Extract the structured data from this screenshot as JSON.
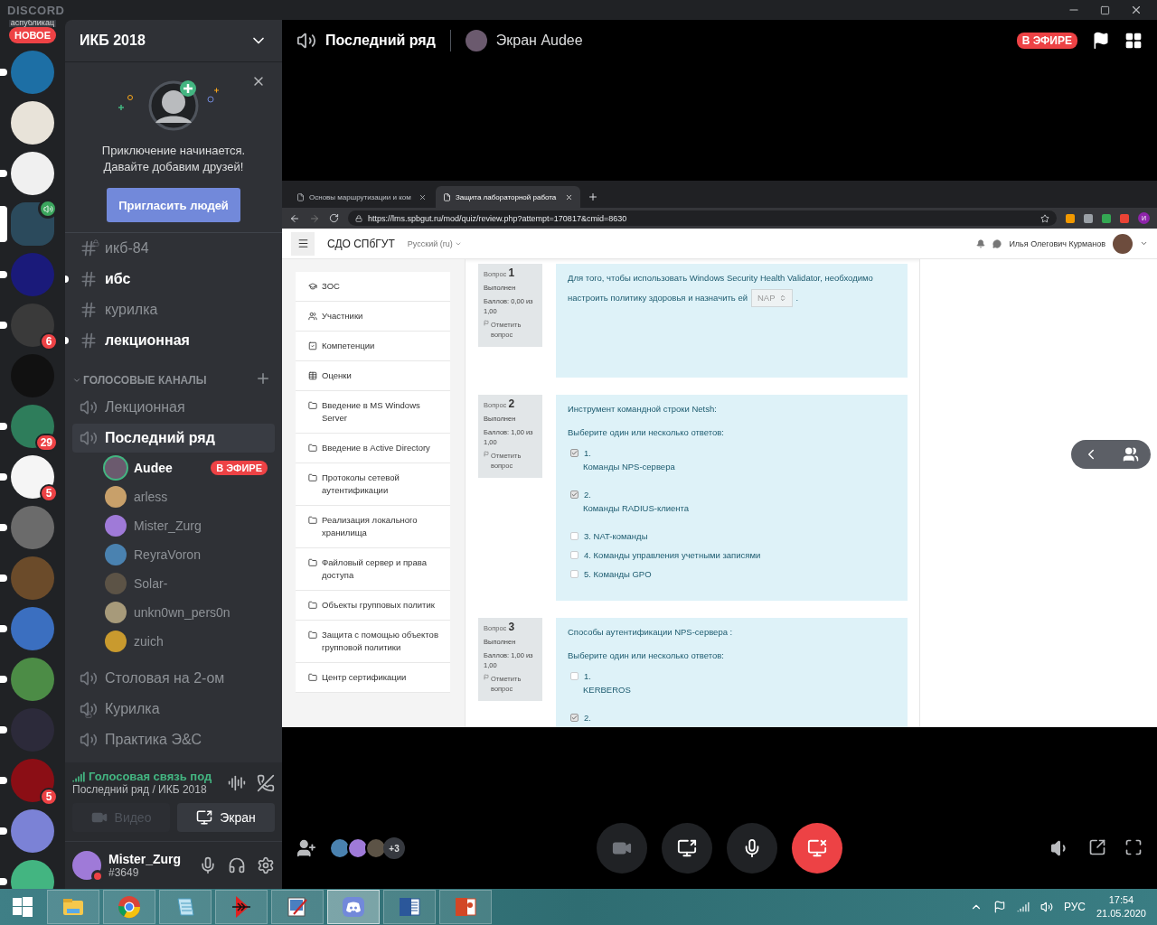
{
  "app_name": "DISCORD",
  "server_list": {
    "caption": "аспубликац",
    "new_badge": "НОВОЕ",
    "servers": [
      {
        "selected": false,
        "unread": true
      },
      {
        "selected": false,
        "unread": false
      },
      {
        "selected": false,
        "unread": true
      },
      {
        "selected": true,
        "unread": false,
        "voice": true
      },
      {
        "selected": false,
        "unread": true
      },
      {
        "selected": false,
        "unread": true,
        "badge": "6"
      },
      {
        "selected": false,
        "unread": false
      },
      {
        "selected": false,
        "unread": true,
        "badge": "29"
      },
      {
        "selected": false,
        "unread": true,
        "badge": "5"
      },
      {
        "selected": false,
        "unread": true
      },
      {
        "selected": false,
        "unread": true
      },
      {
        "selected": false,
        "unread": true
      },
      {
        "selected": false,
        "unread": true
      },
      {
        "selected": false,
        "unread": true
      },
      {
        "selected": false,
        "unread": true,
        "badge": "5"
      },
      {
        "selected": false,
        "unread": true
      },
      {
        "selected": false,
        "unread": true
      }
    ]
  },
  "server": {
    "name": "ИКБ 2018"
  },
  "invite": {
    "text": "Приключение начинается. Давайте добавим друзей!",
    "button": "Пригласить людей"
  },
  "text_channels": [
    {
      "name": "икб-84",
      "unread": false,
      "locked": true
    },
    {
      "name": "ибс",
      "unread": true,
      "locked": false
    },
    {
      "name": "курилка",
      "unread": false,
      "locked": false
    },
    {
      "name": "лекционная",
      "unread": true,
      "locked": false
    }
  ],
  "voice_category": {
    "label": "ГОЛОСОВЫЕ КАНАЛЫ",
    "expanded": true
  },
  "voice_channels": [
    {
      "name": "Лекционная",
      "selected": false,
      "locked": false
    },
    {
      "name": "Последний ряд",
      "selected": true,
      "locked": false,
      "users": [
        {
          "name": "Audee",
          "speaking": true,
          "live": "В ЭФИРЕ"
        },
        {
          "name": "arless",
          "speaking": false
        },
        {
          "name": "Mister_Zurg",
          "speaking": false
        },
        {
          "name": "ReyraVoron",
          "speaking": false
        },
        {
          "name": "Solar-",
          "speaking": false
        },
        {
          "name": "unkn0wn_pers0n",
          "speaking": false
        },
        {
          "name": "zuich",
          "speaking": false
        }
      ]
    },
    {
      "name": "Столовая на 2-ом",
      "selected": false,
      "locked": false
    },
    {
      "name": "Курилка",
      "selected": false,
      "locked": true
    },
    {
      "name": "Практика Э&С",
      "selected": false,
      "locked": false
    }
  ],
  "voice_status": {
    "status": "Голосовая связь под",
    "location": "Последний ряд / ИКБ 2018",
    "buttons": [
      {
        "kind": "video",
        "label": "Видео",
        "disabled": true
      },
      {
        "kind": "screen",
        "label": "Экран",
        "disabled": false
      }
    ]
  },
  "user": {
    "name": "Mister_Zurg",
    "tag": "#3649",
    "do_not_disturb": true
  },
  "members_panel": {
    "expanded": false
  },
  "stream": {
    "channel": "Последний ряд",
    "title": "Экран Audee",
    "live": "В ЭФИРЕ"
  },
  "browser": {
    "tabs": [
      {
        "title": "Основы маршрутизации и ком",
        "selected": false
      },
      {
        "title": "Защита лабораторной работа",
        "selected": true
      }
    ],
    "url": "https://lms.spbgut.ru/mod/quiz/review.php?attempt=170817&cmid=8630",
    "profile": "И",
    "site": {
      "name": "СДО СПбГУТ",
      "language": "Русский (ru)",
      "user": "Илья Олегович Курманов"
    },
    "nav": [
      {
        "kind": "cap",
        "label": "ЗОС"
      },
      {
        "kind": "users",
        "label": "Участники"
      },
      {
        "kind": "check",
        "label": "Компетенции"
      },
      {
        "kind": "table",
        "label": "Оценки"
      },
      {
        "kind": "folder",
        "label": "Введение в MS Windows Server"
      },
      {
        "kind": "folder",
        "label": "Введение в Active Directory"
      },
      {
        "kind": "folder",
        "label": "Протоколы сетевой аутентификации"
      },
      {
        "kind": "folder",
        "label": "Реализация локального хранилища"
      },
      {
        "kind": "folder",
        "label": "Файловый сервер и права доступа"
      },
      {
        "kind": "folder",
        "label": "Объекты групповых политик"
      },
      {
        "kind": "folder",
        "label": "Защита с помощью объектов групповой политики"
      },
      {
        "kind": "folder",
        "label": "Центр сертификации"
      }
    ],
    "questions": [
      {
        "label": "Вопрос",
        "number": "1",
        "state": "Выполнен",
        "score": "Баллов: 0,00 из 1,00",
        "flag": "Отметить вопрос",
        "text": "Для того, чтобы использовать Windows Security Health Validator, необходимо настроить политику здоровья и назначить ей",
        "select": "NAP",
        "after": "."
      },
      {
        "label": "Вопрос",
        "number": "2",
        "state": "Выполнен",
        "score": "Баллов: 1,00 из 1,00",
        "flag": "Отметить вопрос",
        "text": "Инструмент командной строки Netsh:",
        "prompt": "Выберите один или несколько ответов:",
        "options": [
          {
            "kind": "stacked",
            "number": "1.",
            "text": "Команды NPS-сервера",
            "checked": true
          },
          {
            "kind": "stacked",
            "number": "2.",
            "text": "Команды RADIUS-клиента",
            "checked": true
          },
          {
            "kind": "inline",
            "text": "3. NAT-команды",
            "checked": false
          },
          {
            "kind": "inline",
            "text": "4. Команды управления учетными записями",
            "checked": false
          },
          {
            "kind": "inline",
            "text": "5. Команды GPO",
            "checked": false
          }
        ]
      },
      {
        "label": "Вопрос",
        "number": "3",
        "state": "Выполнен",
        "score": "Баллов: 1,00 из 1,00",
        "flag": "Отметить вопрос",
        "text": "Способы аутентификации NPS-сервера :",
        "prompt": "Выберите один или несколько ответов:",
        "options": [
          {
            "kind": "stacked",
            "number": "1.",
            "text": "KERBEROS",
            "checked": false
          },
          {
            "kind": "stacked",
            "number": "2.",
            "checked": true
          }
        ]
      }
    ]
  },
  "call_controls": {
    "viewers_more": "+3",
    "buttons": [
      {
        "kind": "camera",
        "disabled": true
      },
      {
        "kind": "screen",
        "disabled": false
      },
      {
        "kind": "mic",
        "disabled": false
      },
      {
        "kind": "stop",
        "disabled": false
      }
    ]
  },
  "taskbar": {
    "apps": [
      {
        "kind": "explorer",
        "active": false
      },
      {
        "kind": "chrome",
        "active": false
      },
      {
        "kind": "notepad",
        "active": false
      },
      {
        "kind": "arrow",
        "active": false
      },
      {
        "kind": "paint",
        "active": false
      },
      {
        "kind": "discord",
        "active": true
      },
      {
        "kind": "word",
        "active": false
      },
      {
        "kind": "powerpoint",
        "active": false
      }
    ],
    "language": "РУС",
    "time": "17:54",
    "date": "21.05.2020"
  }
}
